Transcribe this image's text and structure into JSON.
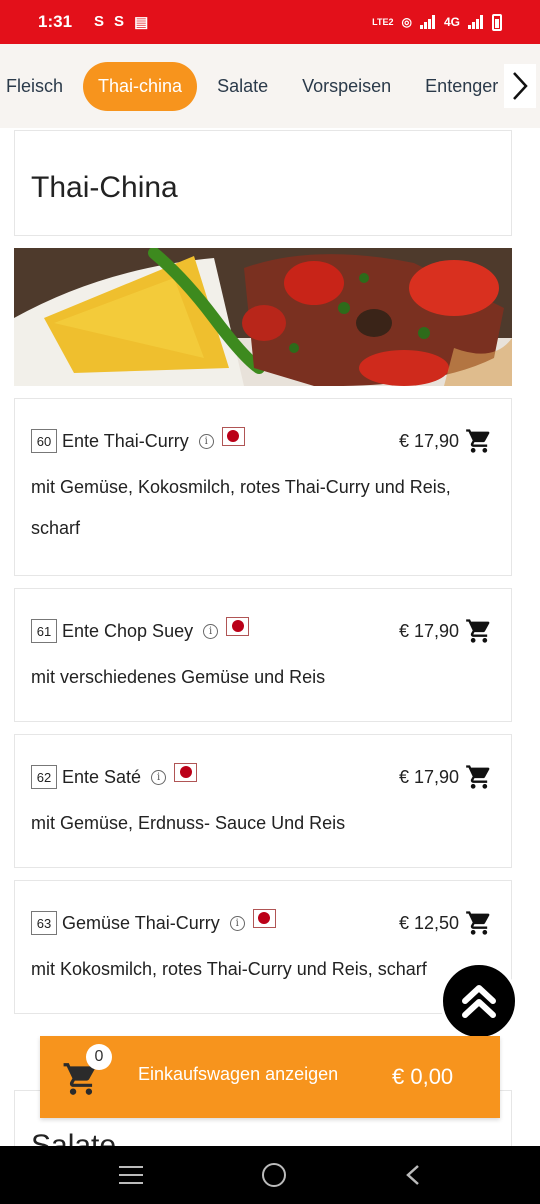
{
  "status_bar": {
    "time": "1:31",
    "left_icons": [
      "S",
      "S",
      "▤"
    ],
    "network": "4G",
    "lte": "LTE2"
  },
  "category_nav": {
    "tabs": [
      {
        "label": "Fleisch",
        "active": false
      },
      {
        "label": "Thai-china",
        "active": true
      },
      {
        "label": "Salate",
        "active": false
      },
      {
        "label": "Vorspeisen",
        "active": false
      },
      {
        "label": "Entenger",
        "active": false
      }
    ],
    "next_icon": "chevron-right-icon"
  },
  "section": {
    "title": "Thai-China"
  },
  "items": [
    {
      "number": "60",
      "name": "Ente Thai-Curry",
      "price": "€ 17,90",
      "description": "mit Gemüse, Kokosmilch, rotes Thai-Curry und Reis, scharf"
    },
    {
      "number": "61",
      "name": "Ente Chop Suey",
      "price": "€ 17,90",
      "description": "mit verschiedenes Gemüse und Reis"
    },
    {
      "number": "62",
      "name": "Ente Saté",
      "price": "€ 17,90",
      "description": "mit Gemüse, Erdnuss- Sauce Und Reis"
    },
    {
      "number": "63",
      "name": "Gemüse Thai-Curry",
      "price": "€ 12,50",
      "description": "mit Kokosmilch, rotes Thai-Curry und Reis, scharf"
    }
  ],
  "next_section": {
    "title": "Salate"
  },
  "cart": {
    "count": "0",
    "label": "Einkaufswagen anzeigen",
    "total": "€ 0,00"
  },
  "colors": {
    "status_red": "#e3101a",
    "accent_orange": "#f7941d"
  }
}
